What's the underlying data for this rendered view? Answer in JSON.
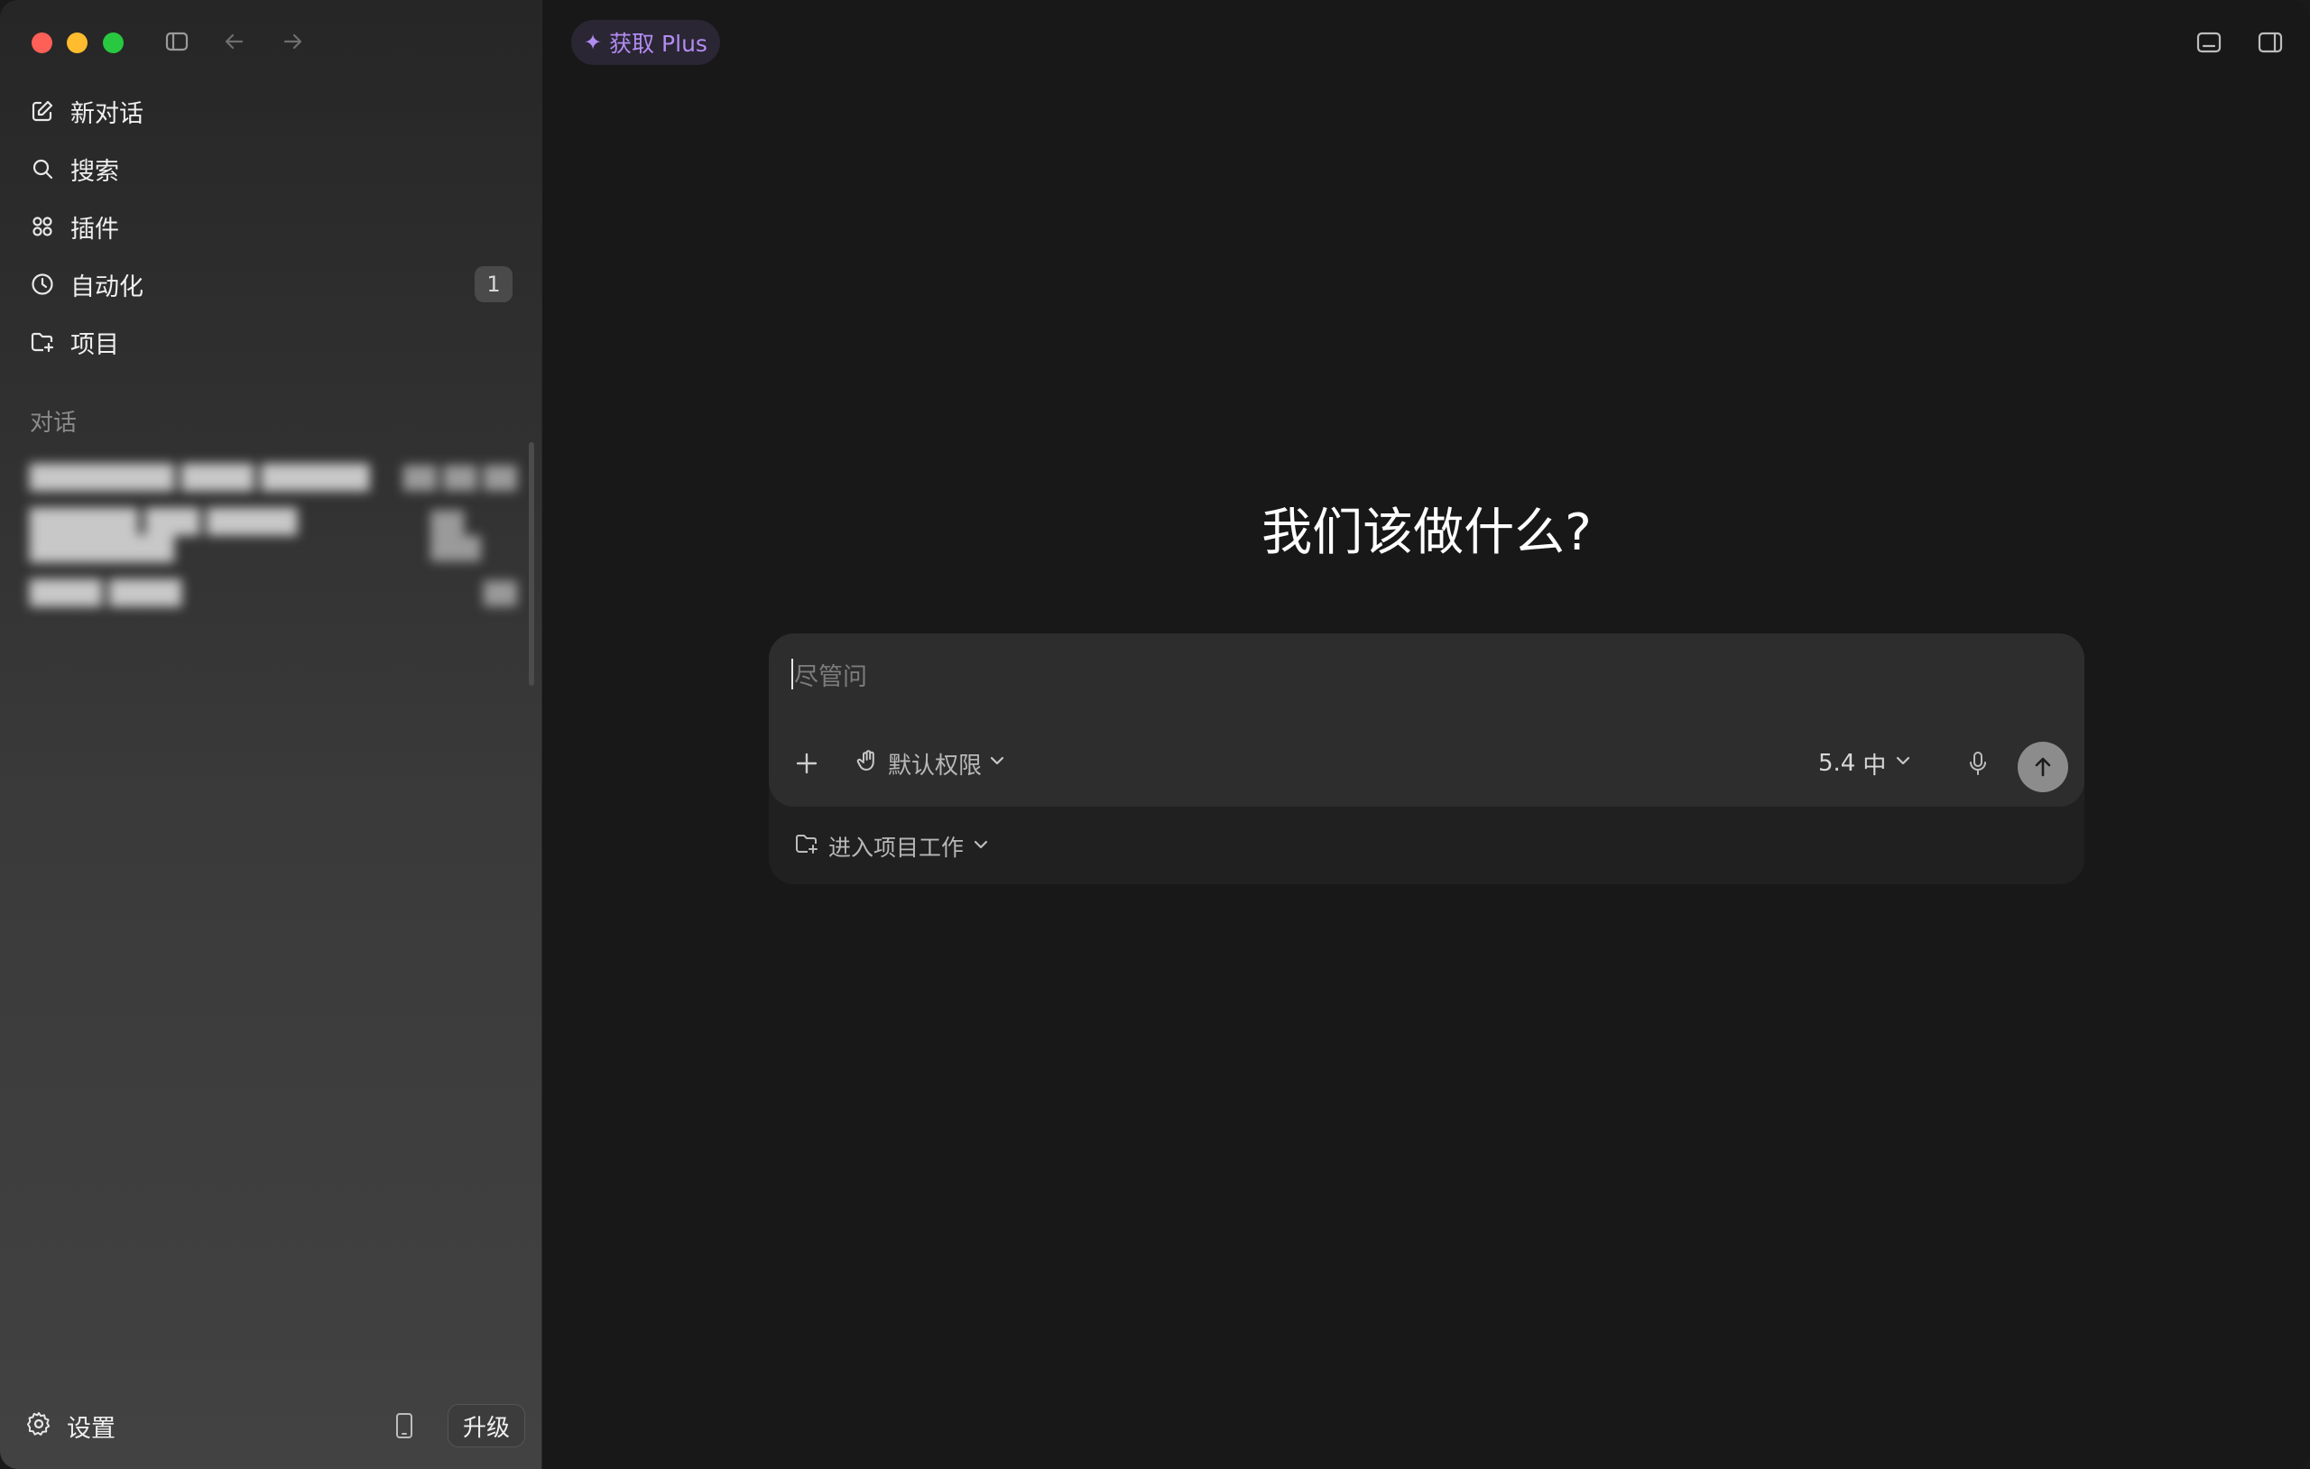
{
  "window": {
    "controls": [
      "close",
      "minimize",
      "zoom"
    ]
  },
  "toolbar": {
    "icons": [
      "sidebar-toggle-icon",
      "back-arrow-icon",
      "forward-arrow-icon"
    ]
  },
  "sidebar": {
    "items": [
      {
        "label": "新对话",
        "icon": "edit-icon"
      },
      {
        "label": "搜索",
        "icon": "search-icon"
      },
      {
        "label": "插件",
        "icon": "plugins-grid-icon"
      },
      {
        "label": "自动化",
        "icon": "clock-icon",
        "badge": "1"
      },
      {
        "label": "项目",
        "icon": "folder-add-icon"
      }
    ],
    "section_title": "对话",
    "conversations": [
      {
        "title": "████████ ████ ██████",
        "time": "██ ██ ██"
      },
      {
        "title": "██████ ███ █████ ████████",
        "time": "██ ███"
      },
      {
        "title": "████ ████",
        "time": "██"
      }
    ],
    "settings_label": "设置",
    "upgrade_label": "升级"
  },
  "header": {
    "plus_label": "获取 Plus",
    "accent": "#b38cf2"
  },
  "main": {
    "heading": "我们该做什么?",
    "composer": {
      "placeholder": "尽管问",
      "permission_label": "默认权限",
      "model_version": "5.4",
      "model_effort": "中"
    },
    "project_label": "进入项目工作"
  }
}
